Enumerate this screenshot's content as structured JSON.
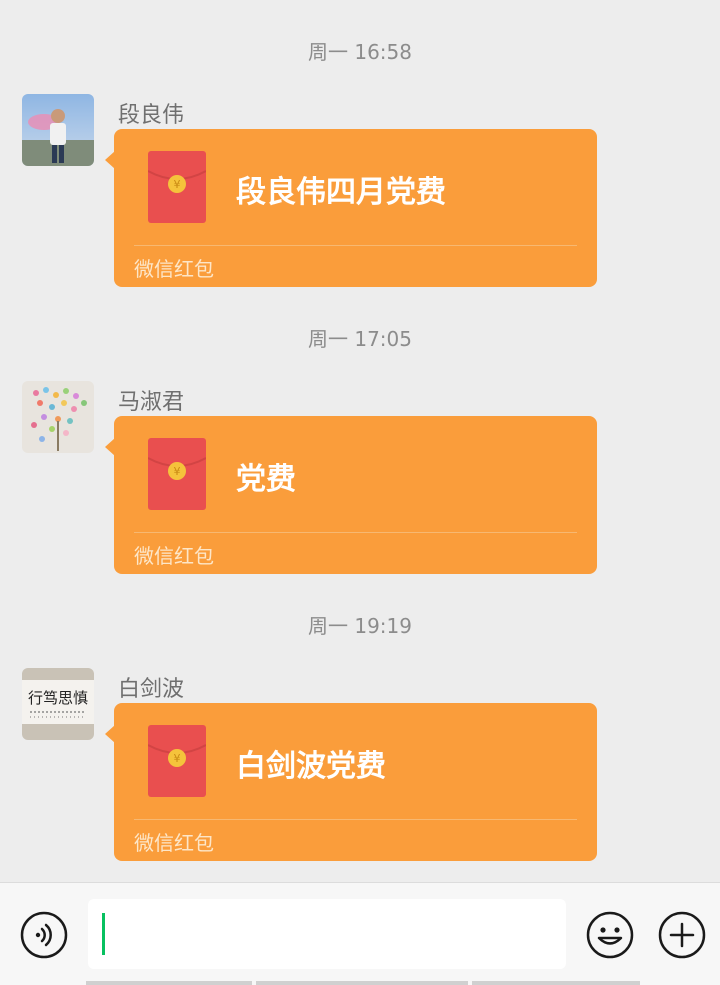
{
  "messages": [
    {
      "time": "周一 16:58",
      "sender": "段良伟",
      "red_packet": {
        "title": "段良伟四月党费",
        "footer": "微信红包"
      }
    },
    {
      "time": "周一 17:05",
      "sender": "马淑君",
      "red_packet": {
        "title": "党费",
        "footer": "微信红包"
      }
    },
    {
      "time": "周一 19:19",
      "sender": "白剑波",
      "red_packet": {
        "title": "白剑波党费",
        "footer": "微信红包"
      }
    }
  ],
  "avatar3_text": "行笃思慎",
  "icons": {
    "voice": "voice-icon",
    "emoji": "emoji-icon",
    "more": "plus-icon",
    "red_packet": "red-packet-icon"
  },
  "colors": {
    "red_packet_bubble": "#fa9d3b",
    "red_packet_envelope": "#e94f4f",
    "coin": "#f5c33b",
    "caret": "#07c160"
  },
  "input": {
    "value": ""
  }
}
